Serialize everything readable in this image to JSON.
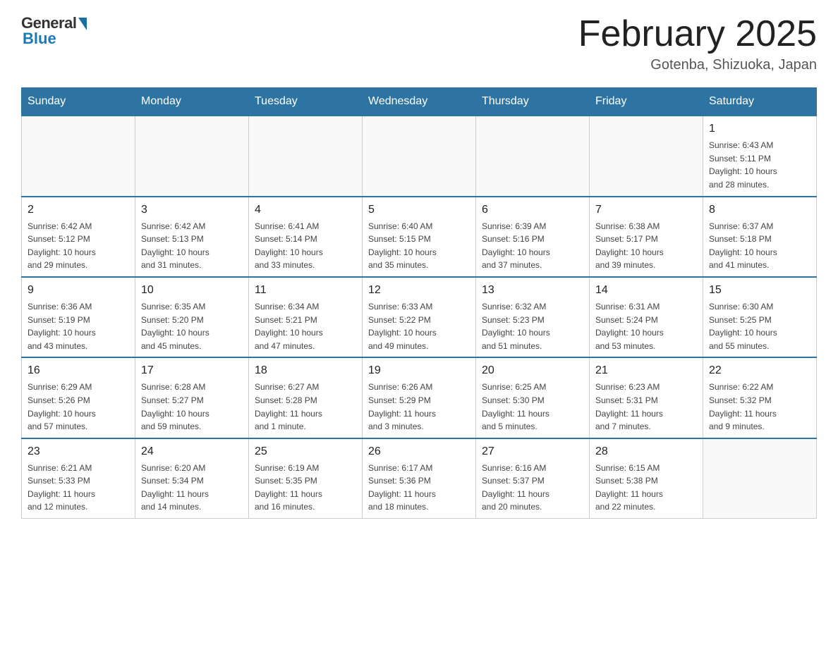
{
  "logo": {
    "general": "General",
    "blue": "Blue"
  },
  "header": {
    "month": "February 2025",
    "location": "Gotenba, Shizuoka, Japan"
  },
  "weekdays": [
    "Sunday",
    "Monday",
    "Tuesday",
    "Wednesday",
    "Thursday",
    "Friday",
    "Saturday"
  ],
  "weeks": [
    [
      {
        "day": "",
        "info": ""
      },
      {
        "day": "",
        "info": ""
      },
      {
        "day": "",
        "info": ""
      },
      {
        "day": "",
        "info": ""
      },
      {
        "day": "",
        "info": ""
      },
      {
        "day": "",
        "info": ""
      },
      {
        "day": "1",
        "info": "Sunrise: 6:43 AM\nSunset: 5:11 PM\nDaylight: 10 hours\nand 28 minutes."
      }
    ],
    [
      {
        "day": "2",
        "info": "Sunrise: 6:42 AM\nSunset: 5:12 PM\nDaylight: 10 hours\nand 29 minutes."
      },
      {
        "day": "3",
        "info": "Sunrise: 6:42 AM\nSunset: 5:13 PM\nDaylight: 10 hours\nand 31 minutes."
      },
      {
        "day": "4",
        "info": "Sunrise: 6:41 AM\nSunset: 5:14 PM\nDaylight: 10 hours\nand 33 minutes."
      },
      {
        "day": "5",
        "info": "Sunrise: 6:40 AM\nSunset: 5:15 PM\nDaylight: 10 hours\nand 35 minutes."
      },
      {
        "day": "6",
        "info": "Sunrise: 6:39 AM\nSunset: 5:16 PM\nDaylight: 10 hours\nand 37 minutes."
      },
      {
        "day": "7",
        "info": "Sunrise: 6:38 AM\nSunset: 5:17 PM\nDaylight: 10 hours\nand 39 minutes."
      },
      {
        "day": "8",
        "info": "Sunrise: 6:37 AM\nSunset: 5:18 PM\nDaylight: 10 hours\nand 41 minutes."
      }
    ],
    [
      {
        "day": "9",
        "info": "Sunrise: 6:36 AM\nSunset: 5:19 PM\nDaylight: 10 hours\nand 43 minutes."
      },
      {
        "day": "10",
        "info": "Sunrise: 6:35 AM\nSunset: 5:20 PM\nDaylight: 10 hours\nand 45 minutes."
      },
      {
        "day": "11",
        "info": "Sunrise: 6:34 AM\nSunset: 5:21 PM\nDaylight: 10 hours\nand 47 minutes."
      },
      {
        "day": "12",
        "info": "Sunrise: 6:33 AM\nSunset: 5:22 PM\nDaylight: 10 hours\nand 49 minutes."
      },
      {
        "day": "13",
        "info": "Sunrise: 6:32 AM\nSunset: 5:23 PM\nDaylight: 10 hours\nand 51 minutes."
      },
      {
        "day": "14",
        "info": "Sunrise: 6:31 AM\nSunset: 5:24 PM\nDaylight: 10 hours\nand 53 minutes."
      },
      {
        "day": "15",
        "info": "Sunrise: 6:30 AM\nSunset: 5:25 PM\nDaylight: 10 hours\nand 55 minutes."
      }
    ],
    [
      {
        "day": "16",
        "info": "Sunrise: 6:29 AM\nSunset: 5:26 PM\nDaylight: 10 hours\nand 57 minutes."
      },
      {
        "day": "17",
        "info": "Sunrise: 6:28 AM\nSunset: 5:27 PM\nDaylight: 10 hours\nand 59 minutes."
      },
      {
        "day": "18",
        "info": "Sunrise: 6:27 AM\nSunset: 5:28 PM\nDaylight: 11 hours\nand 1 minute."
      },
      {
        "day": "19",
        "info": "Sunrise: 6:26 AM\nSunset: 5:29 PM\nDaylight: 11 hours\nand 3 minutes."
      },
      {
        "day": "20",
        "info": "Sunrise: 6:25 AM\nSunset: 5:30 PM\nDaylight: 11 hours\nand 5 minutes."
      },
      {
        "day": "21",
        "info": "Sunrise: 6:23 AM\nSunset: 5:31 PM\nDaylight: 11 hours\nand 7 minutes."
      },
      {
        "day": "22",
        "info": "Sunrise: 6:22 AM\nSunset: 5:32 PM\nDaylight: 11 hours\nand 9 minutes."
      }
    ],
    [
      {
        "day": "23",
        "info": "Sunrise: 6:21 AM\nSunset: 5:33 PM\nDaylight: 11 hours\nand 12 minutes."
      },
      {
        "day": "24",
        "info": "Sunrise: 6:20 AM\nSunset: 5:34 PM\nDaylight: 11 hours\nand 14 minutes."
      },
      {
        "day": "25",
        "info": "Sunrise: 6:19 AM\nSunset: 5:35 PM\nDaylight: 11 hours\nand 16 minutes."
      },
      {
        "day": "26",
        "info": "Sunrise: 6:17 AM\nSunset: 5:36 PM\nDaylight: 11 hours\nand 18 minutes."
      },
      {
        "day": "27",
        "info": "Sunrise: 6:16 AM\nSunset: 5:37 PM\nDaylight: 11 hours\nand 20 minutes."
      },
      {
        "day": "28",
        "info": "Sunrise: 6:15 AM\nSunset: 5:38 PM\nDaylight: 11 hours\nand 22 minutes."
      },
      {
        "day": "",
        "info": ""
      }
    ]
  ]
}
